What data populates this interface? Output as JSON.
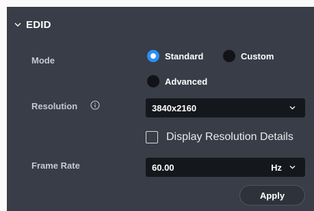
{
  "section": {
    "title": "EDID"
  },
  "mode": {
    "label": "Mode",
    "options": [
      {
        "label": "Standard",
        "checked": true
      },
      {
        "label": "Custom",
        "checked": false
      },
      {
        "label": "Advanced",
        "checked": false
      }
    ]
  },
  "resolution": {
    "label": "Resolution",
    "value": "3840x2160",
    "details_label": "Display Resolution Details",
    "details_checked": false
  },
  "frame_rate": {
    "label": "Frame Rate",
    "value": "60.00",
    "unit": "Hz"
  },
  "apply_label": "Apply",
  "icons": {
    "toggle": "chevron-down-icon",
    "info": "info-icon",
    "dropdown": "chevron-down-icon"
  },
  "colors": {
    "panel": "#383d47",
    "accent": "#2a8ff7",
    "field": "#14171c"
  }
}
